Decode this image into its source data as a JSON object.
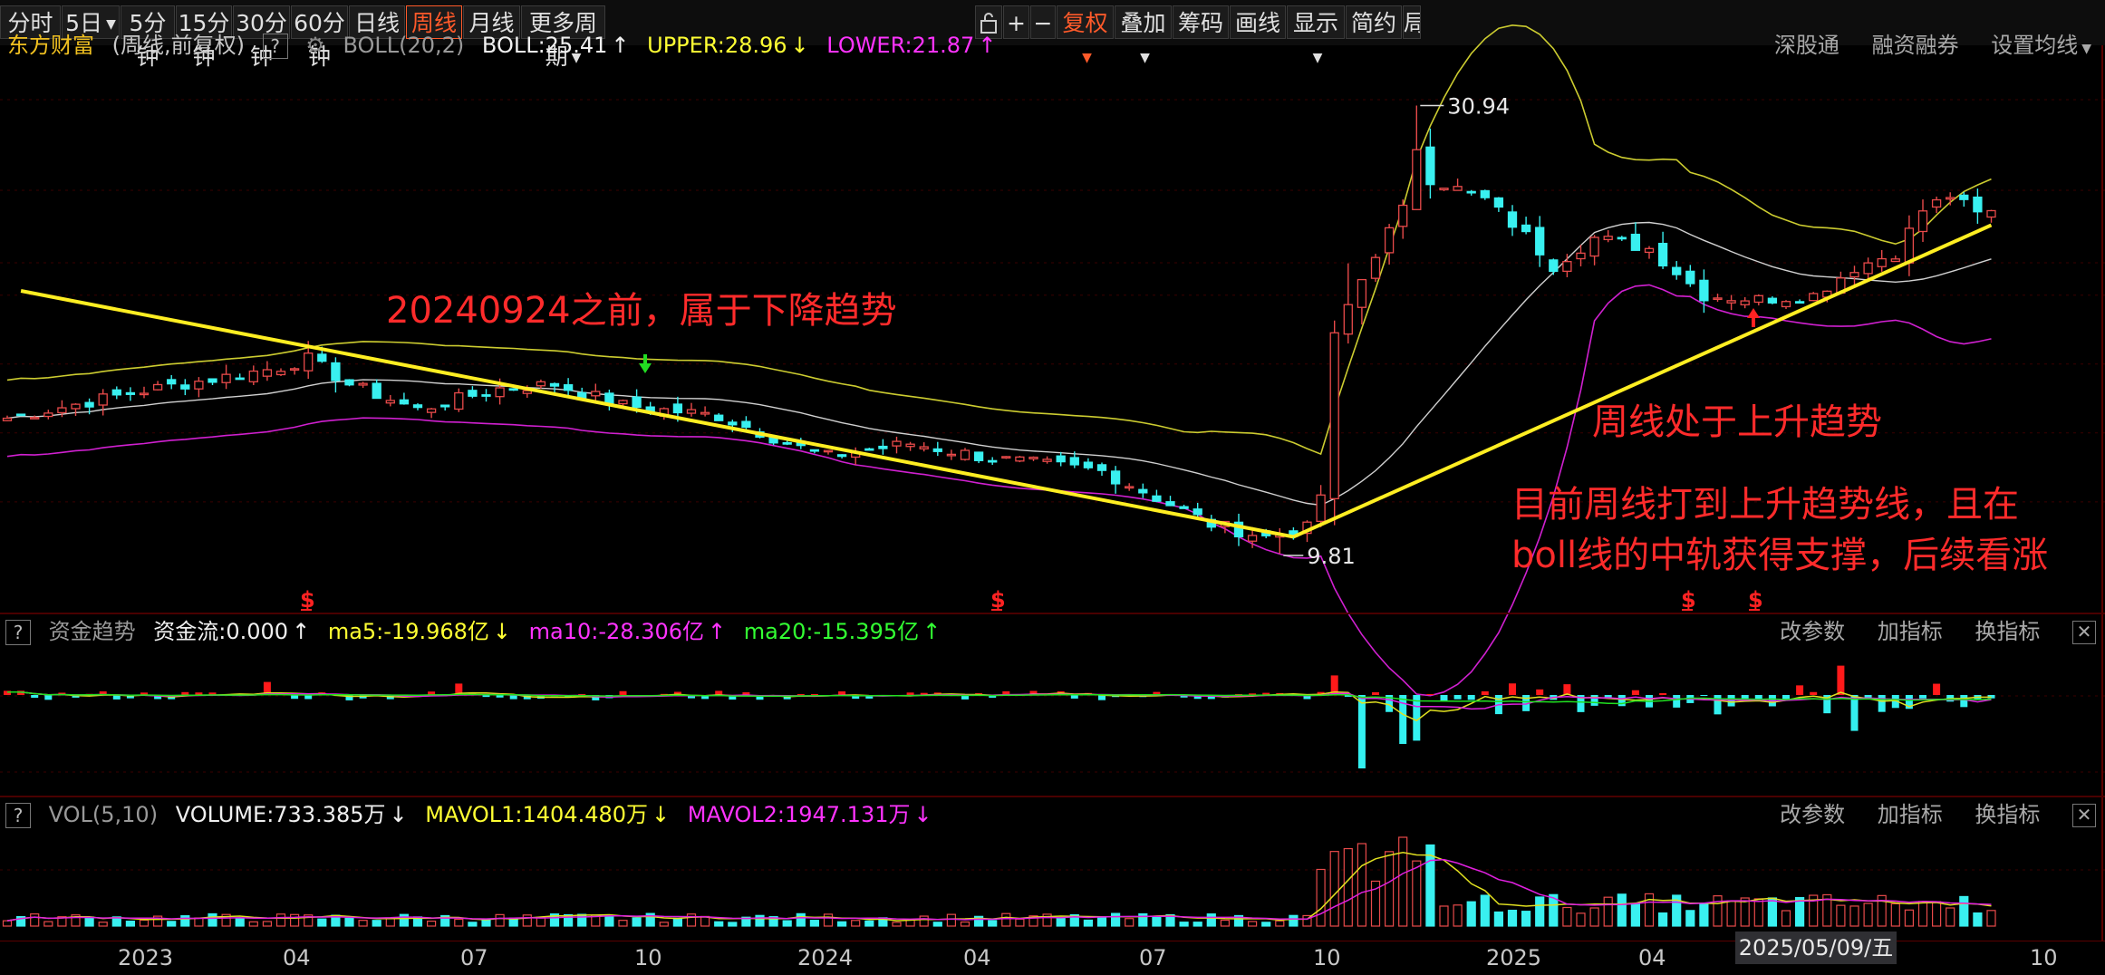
{
  "toolbar": {
    "periods": [
      "分时",
      "5日",
      "5分钟",
      "15分钟",
      "30分钟",
      "60分钟",
      "日线",
      "周线",
      "月线",
      "更多周期"
    ],
    "active_period": "周线",
    "right_icons": [
      "lock-icon",
      "plus-icon",
      "minus-icon"
    ],
    "right_buttons": [
      "复权",
      "叠加",
      "筹码",
      "画线",
      "显示",
      "简约",
      "局"
    ]
  },
  "main_panel": {
    "stock_name": "东方财富",
    "period_note": "(周线,前复权)",
    "indicator": "BOLL(20,2)",
    "boll_label": "BOLL:25.41",
    "upper_label": "UPPER:28.96",
    "lower_label": "LOWER:21.87",
    "right_links": [
      "深股通",
      "融资融券",
      "设置均线"
    ],
    "high_label": "30.94",
    "low_label": "9.81",
    "annotations": {
      "down_trend": "20240924之前，属于下降趋势",
      "up_trend": "周线处于上升趋势",
      "comment_line1": "目前周线打到上升趋势线，且在",
      "comment_line2": "boll线的中轨获得支撑，后续看涨"
    },
    "signal_glyph": "$"
  },
  "fund_panel": {
    "title": "资金趋势",
    "flow_label": "资金流:0.000",
    "ma5_label": "ma5:-19.968亿",
    "ma10_label": "ma10:-28.306亿",
    "ma20_label": "ma20:-15.395亿",
    "right_links": [
      "改参数",
      "加指标",
      "换指标"
    ]
  },
  "vol_panel": {
    "title": "VOL(5,10)",
    "volume_label": "VOLUME:733.385万",
    "mavol1_label": "MAVOL1:1404.480万",
    "mavol2_label": "MAVOL2:1947.131万",
    "right_links": [
      "改参数",
      "加指标",
      "换指标"
    ]
  },
  "x_axis": {
    "labels": [
      "2023",
      "04",
      "07",
      "10",
      "2024",
      "04",
      "07",
      "10",
      "2025",
      "04",
      "10"
    ],
    "cursor_date": "2025/05/09/五"
  },
  "colors": {
    "up": "#e84a4a",
    "down": "#39f0f0",
    "mid_band": "#d0d0d0",
    "upper_band": "#cccc30",
    "lower_band": "#d020d0",
    "trendline": "#ffee22",
    "annotation": "#ff2b2b"
  },
  "chart_data": [
    {
      "type": "candlestick",
      "title": "东方财富",
      "subtitle": "(周线,前复权)",
      "x_tick_labels": [
        "2023",
        "04",
        "07",
        "10",
        "2024",
        "04",
        "07",
        "10",
        "2025",
        "04",
        "10"
      ],
      "period_count": 146,
      "ylim": [
        7.5,
        32.5
      ],
      "y_labels_visible": false,
      "ohlc": [],
      "indicators": [
        {
          "name": "BOLL",
          "value": 25.41
        },
        {
          "name": "UPPER",
          "value": 28.96
        },
        {
          "name": "LOWER",
          "value": 21.87
        }
      ],
      "extremes": {
        "high": 30.94,
        "low": 9.81
      },
      "anchors": [
        {
          "i": 0,
          "c": 16.2
        },
        {
          "i": 10,
          "c": 17.5
        },
        {
          "i": 20,
          "c": 18.6
        },
        {
          "i": 22,
          "c": 19.0
        },
        {
          "i": 25,
          "c": 17.8
        },
        {
          "i": 30,
          "c": 16.6
        },
        {
          "i": 36,
          "c": 17.6
        },
        {
          "i": 40,
          "c": 17.8
        },
        {
          "i": 45,
          "c": 16.8
        },
        {
          "i": 52,
          "c": 16.3
        },
        {
          "i": 58,
          "c": 14.8
        },
        {
          "i": 60,
          "c": 14.4
        },
        {
          "i": 66,
          "c": 15.0
        },
        {
          "i": 72,
          "c": 14.3
        },
        {
          "i": 80,
          "c": 13.7
        },
        {
          "i": 88,
          "c": 11.2
        },
        {
          "i": 92,
          "c": 10.6
        },
        {
          "i": 95,
          "c": 11.0
        },
        {
          "i": 96,
          "c": 12.6
        },
        {
          "i": 97,
          "c": 20.0
        },
        {
          "i": 98,
          "c": 21.5
        },
        {
          "i": 100,
          "c": 24.0
        },
        {
          "i": 102,
          "c": 26.0
        },
        {
          "i": 103,
          "c": 29.0
        },
        {
          "i": 104,
          "c": 27.5
        },
        {
          "i": 106,
          "c": 27.0
        },
        {
          "i": 108,
          "c": 26.5
        },
        {
          "i": 111,
          "c": 24.8
        },
        {
          "i": 113,
          "c": 23.4
        },
        {
          "i": 116,
          "c": 24.7
        },
        {
          "i": 120,
          "c": 24.2
        },
        {
          "i": 124,
          "c": 22.0
        },
        {
          "i": 128,
          "c": 21.8
        },
        {
          "i": 132,
          "c": 22.0
        },
        {
          "i": 135,
          "c": 23.3
        },
        {
          "i": 138,
          "c": 24.0
        },
        {
          "i": 140,
          "c": 26.0
        },
        {
          "i": 142,
          "c": 26.7
        },
        {
          "i": 144,
          "c": 25.8
        },
        {
          "i": 145,
          "c": 25.9
        }
      ],
      "lines": [
        {
          "name": "降趋势线",
          "from": {
            "i": 1,
            "v": 22.2
          },
          "to": {
            "i": 94,
            "v": 10.6
          }
        },
        {
          "name": "升趋势线",
          "from": {
            "i": 94,
            "v": 10.6
          },
          "to": {
            "i": 145,
            "v": 25.3
          }
        }
      ]
    },
    {
      "type": "bar",
      "title": "资金趋势",
      "series": [
        {
          "name": "资金流",
          "last_value": 0.0
        },
        {
          "name": "ma5",
          "last_value": -19.968,
          "unit": "亿"
        },
        {
          "name": "ma10",
          "last_value": -28.306,
          "unit": "亿"
        },
        {
          "name": "ma20",
          "last_value": -15.395,
          "unit": "亿"
        }
      ],
      "spikes": [
        {
          "i": 97,
          "v": 12
        },
        {
          "i": 99,
          "v": -45
        },
        {
          "i": 102,
          "v": -30
        },
        {
          "i": 103,
          "v": -28
        },
        {
          "i": 134,
          "v": 18
        },
        {
          "i": 135,
          "v": -22
        },
        {
          "i": 19,
          "v": 8
        },
        {
          "i": 33,
          "v": 7
        }
      ]
    },
    {
      "type": "bar",
      "title": "VOL(5,10)",
      "series": [
        {
          "name": "VOLUME",
          "last_value": 733.385,
          "unit": "万"
        },
        {
          "name": "MAVOL1",
          "last_value": 1404.48,
          "unit": "万"
        },
        {
          "name": "MAVOL2",
          "last_value": 1947.131,
          "unit": "万"
        }
      ]
    }
  ]
}
